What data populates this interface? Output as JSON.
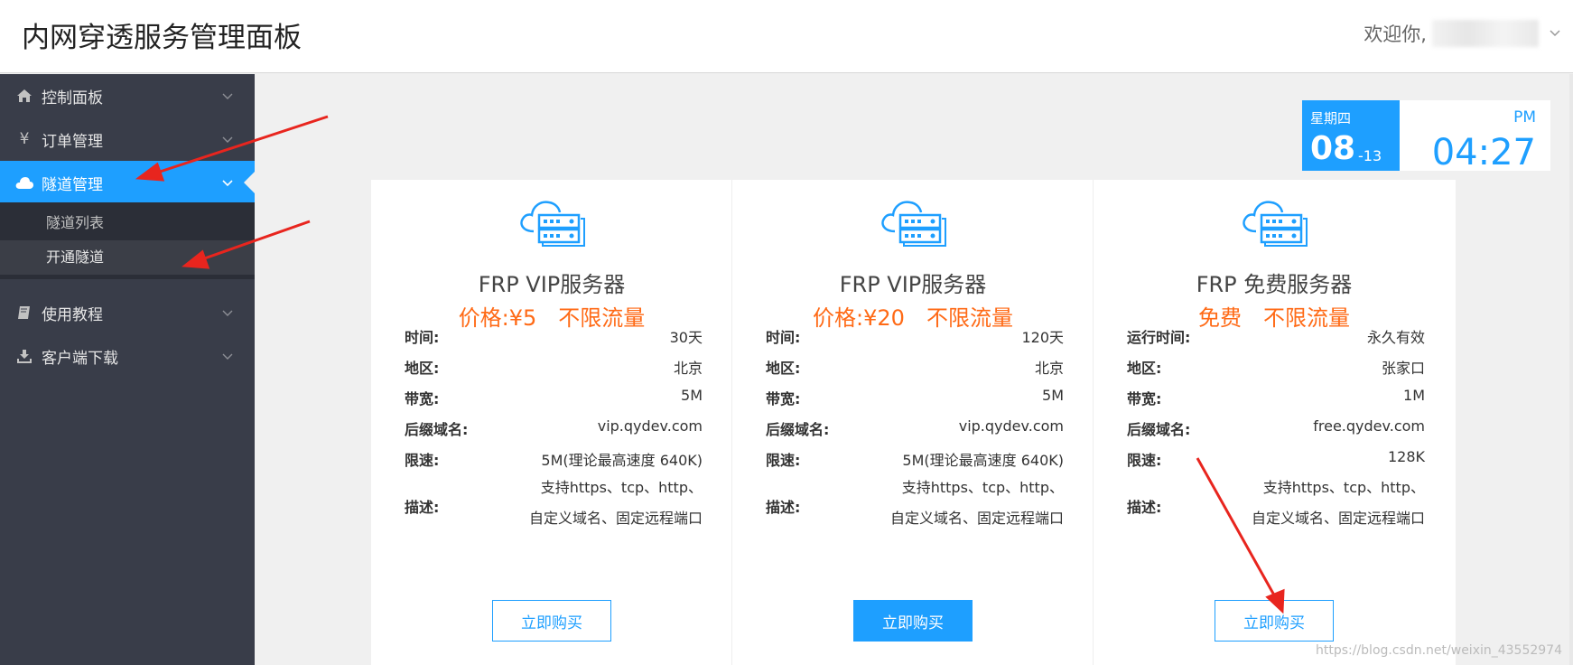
{
  "header": {
    "title": "内网穿透服务管理面板",
    "welcome": "欢迎你,"
  },
  "sidebar": {
    "items": [
      {
        "label": "控制面板",
        "icon": "home-icon"
      },
      {
        "label": "订单管理",
        "icon": "yen-icon",
        "icon_glyph": "¥"
      },
      {
        "label": "隧道管理",
        "icon": "cloud-icon"
      },
      {
        "label": "使用教程",
        "icon": "book-icon"
      },
      {
        "label": "客户端下载",
        "icon": "download-icon"
      }
    ],
    "submenu": [
      "隧道列表",
      "开通隧道"
    ],
    "active_index": 2,
    "active_sub_index": 1
  },
  "date_widget": {
    "weekday": "星期四",
    "day": "08",
    "month": "-13",
    "ampm": "PM",
    "time": "04:27"
  },
  "plans": [
    {
      "title": "FRP VIP服务器",
      "price": "价格:¥5　不限流量",
      "specs": [
        {
          "k": "时间:",
          "v": "30天"
        },
        {
          "k": "地区:",
          "v": "北京"
        },
        {
          "k": "带宽:",
          "v": "5M"
        },
        {
          "k": "后缀域名:",
          "v": "vip.qydev.com"
        },
        {
          "k": "限速:",
          "v": "5M(理论最高速度 640K)"
        }
      ],
      "desc_label": "描述:",
      "desc_lines": [
        "支持https、tcp、http、",
        "自定义域名、固定远程端口"
      ],
      "button": "立即购买",
      "button_style": "outline"
    },
    {
      "title": "FRP VIP服务器",
      "price": "价格:¥20　不限流量",
      "specs": [
        {
          "k": "时间:",
          "v": "120天"
        },
        {
          "k": "地区:",
          "v": "北京"
        },
        {
          "k": "带宽:",
          "v": "5M"
        },
        {
          "k": "后缀域名:",
          "v": "vip.qydev.com"
        },
        {
          "k": "限速:",
          "v": "5M(理论最高速度 640K)"
        }
      ],
      "desc_label": "描述:",
      "desc_lines": [
        "支持https、tcp、http、",
        "自定义域名、固定远程端口"
      ],
      "button": "立即购买",
      "button_style": "filled"
    },
    {
      "title": "FRP 免费服务器",
      "price": "免费　不限流量",
      "specs": [
        {
          "k": "运行时间:",
          "v": "永久有效"
        },
        {
          "k": "地区:",
          "v": "张家口"
        },
        {
          "k": "带宽:",
          "v": "1M"
        },
        {
          "k": "后缀域名:",
          "v": "free.qydev.com"
        },
        {
          "k": "限速:",
          "v": "128K"
        }
      ],
      "desc_label": "描述:",
      "desc_lines": [
        "支持https、tcp、http、",
        "自定义域名、固定远程端口"
      ],
      "button": "立即购买",
      "button_style": "outline"
    }
  ],
  "watermark": "https://blog.csdn.net/weixin_43552974",
  "colors": {
    "accent": "#1e9fff",
    "price": "#ff6a16",
    "sidebar": "#393d49",
    "annotation_arrow": "#e8251e"
  }
}
